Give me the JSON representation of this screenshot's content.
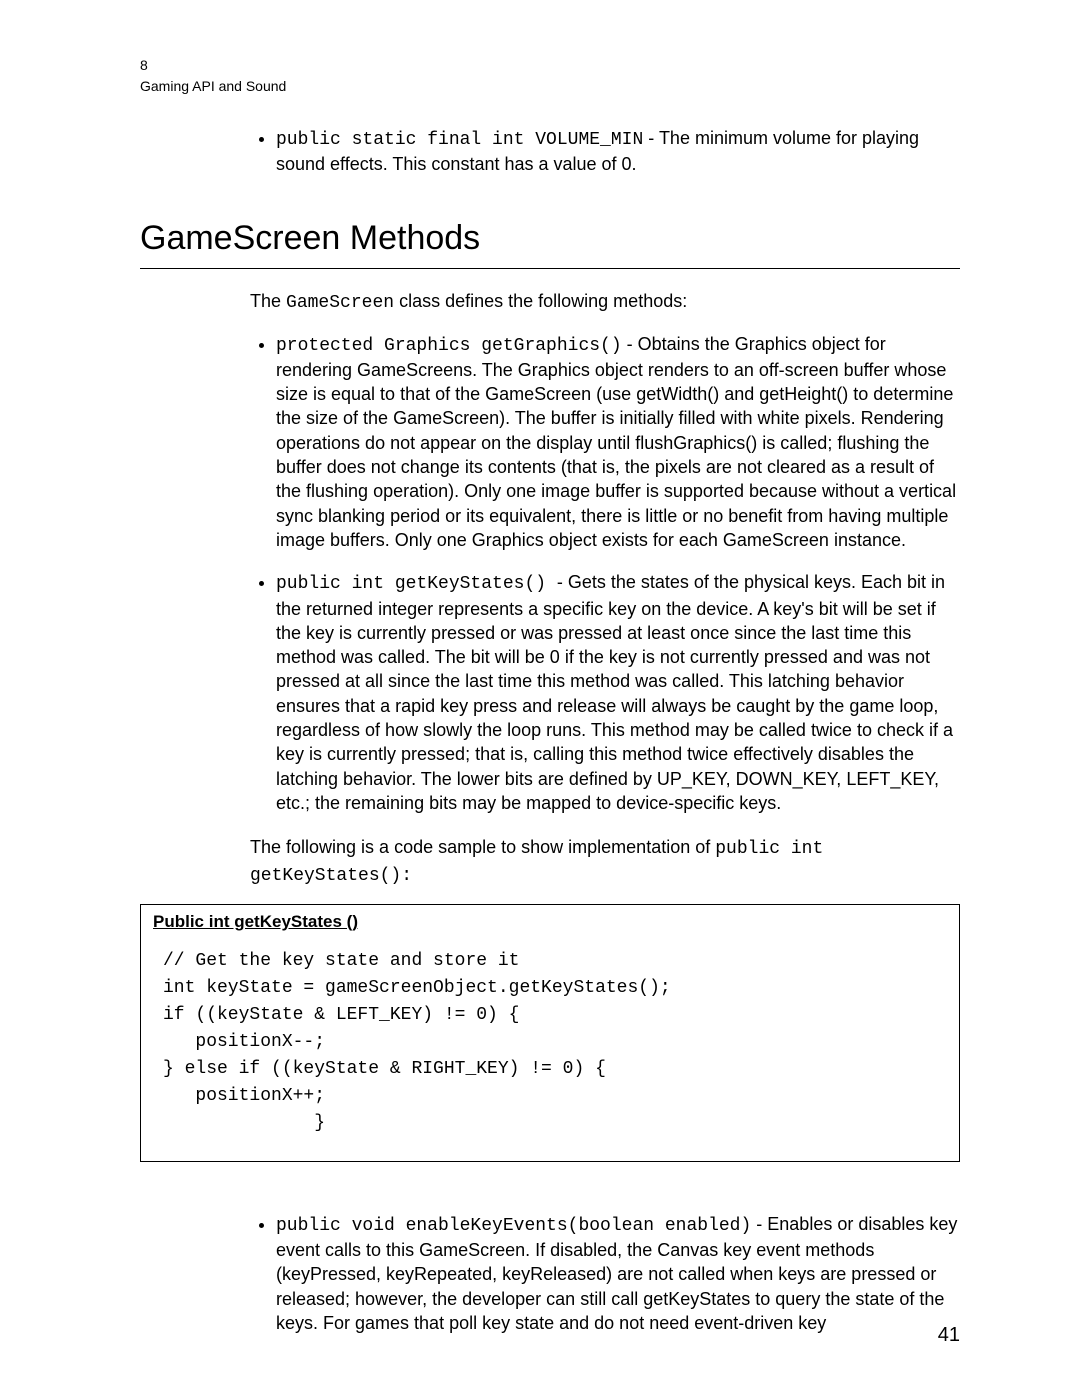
{
  "header": {
    "page_top": "8",
    "section_title": "Gaming API and Sound"
  },
  "top_bullet": {
    "code": "public static final int VOLUME_MIN",
    "sep": " - ",
    "text": "The minimum volume for playing sound effects. This constant has a value of 0."
  },
  "section_heading": "GameScreen Methods",
  "intro_pre": "The ",
  "intro_code": "GameScreen",
  "intro_post": " class defines the following methods:",
  "methods": [
    {
      "code": "protected Graphics getGraphics()",
      "sep": " - ",
      "text": "Obtains the Graphics object for rendering GameScreens. The Graphics object renders to an off-screen buffer whose size is equal to that of the GameScreen (use getWidth() and getHeight() to determine the size of the GameScreen). The buffer is initially filled with white pixels. Rendering operations do not appear on the display until flushGraphics() is called; flushing the buffer does not change its contents (that is, the pixels are not cleared as a result of the flushing operation).  Only one image buffer is supported because without a vertical sync blanking period or its equivalent, there is little or no benefit from having multiple image buffers. Only one Graphics object exists for each GameScreen instance."
    },
    {
      "code": "public int getKeyStates() ",
      "sep": " - ",
      "text": "Gets the states of the physical keys. Each bit in the returned integer represents a specific key on the device. A key's bit will be set if the key is currently pressed or was pressed at least once since the last time this method was called. The bit will be 0 if the key is not currently pressed and was not pressed at all since the last time this method was called. This latching behavior ensures that a rapid key press and release will always be caught by the game loop, regardless of how slowly the loop runs. This method may be called twice to check if a key is currently pressed; that is, calling this method twice effectively disables the latching behavior. The lower bits are defined by UP_KEY, DOWN_KEY, LEFT_KEY, etc.; the remaining bits may be mapped to device-specific keys."
    }
  ],
  "sample_intro_pre": "The following is a code sample to show implementation of ",
  "sample_intro_code": "public int getKeyStates():",
  "codebox": {
    "title": "Public int getKeyStates ()",
    "code": "// Get the key state and store it\nint keyState = gameScreenObject.getKeyStates();\nif ((keyState & LEFT_KEY) != 0) {\n   positionX--;\n} else if ((keyState & RIGHT_KEY) != 0) {\n   positionX++;\n              }"
  },
  "bottom_bullet": {
    "code": "public void enableKeyEvents(boolean enabled)",
    "sep": " - ",
    "text": "Enables or disables key event calls to this GameScreen. If disabled, the Canvas key event methods (keyPressed, keyRepeated, keyReleased) are not called when keys are pressed or released; however, the developer can still call getKeyStates to query the state of the keys. For games that poll key state and do not need event-driven key"
  },
  "footer_page": "41"
}
